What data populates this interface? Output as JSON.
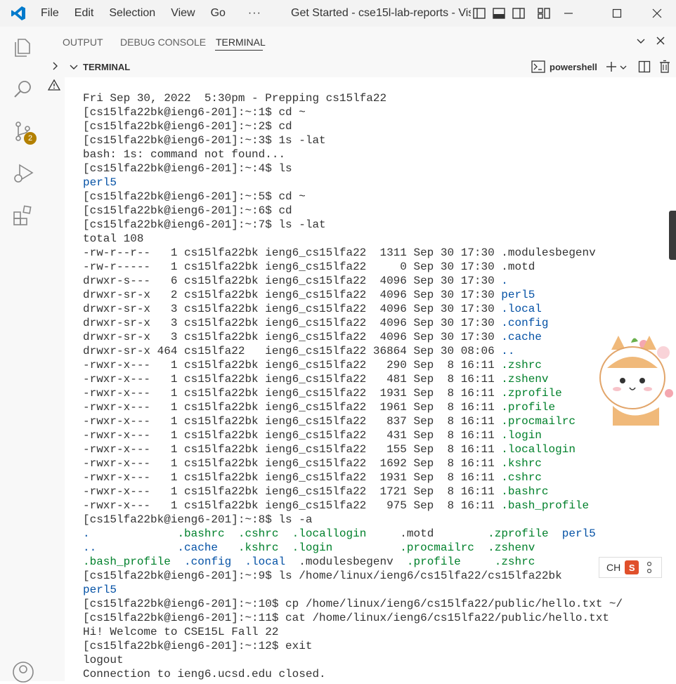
{
  "menu": [
    "File",
    "Edit",
    "Selection",
    "View",
    "Go"
  ],
  "menu_more": "···",
  "window_title": "Get Started - cse15l-lab-reports - Vis",
  "activity": {
    "scm_badge": "2"
  },
  "panel_tabs": [
    {
      "label": "OUTPUT",
      "active": false
    },
    {
      "label": "DEBUG CONSOLE",
      "active": false
    },
    {
      "label": "TERMINAL",
      "active": true
    }
  ],
  "terminal_header": {
    "title": "TERMINAL",
    "shell": "powershell"
  },
  "ime": {
    "label": "CH",
    "logo": "S"
  },
  "colors": {
    "accent": "#007acc",
    "blue_text": "#0451a5",
    "green_text": "#00802b",
    "badge": "#b38000"
  },
  "terminal_lines": [
    [
      {
        "t": "Fri Sep 30, 2022  5:30pm - Prepping cs15lfa22"
      }
    ],
    [
      {
        "t": "[cs15lfa22bk@ieng6-201]:~:1$ cd ~"
      }
    ],
    [
      {
        "t": "[cs15lfa22bk@ieng6-201]:~:2$ cd"
      }
    ],
    [
      {
        "t": "[cs15lfa22bk@ieng6-201]:~:3$ 1s -lat"
      }
    ],
    [
      {
        "t": "bash: 1s: command not found..."
      }
    ],
    [
      {
        "t": "[cs15lfa22bk@ieng6-201]:~:4$ ls"
      }
    ],
    [
      {
        "t": "perl5",
        "c": "blue"
      }
    ],
    [
      {
        "t": "[cs15lfa22bk@ieng6-201]:~:5$ cd ~"
      }
    ],
    [
      {
        "t": "[cs15lfa22bk@ieng6-201]:~:6$ cd"
      }
    ],
    [
      {
        "t": "[cs15lfa22bk@ieng6-201]:~:7$ ls -lat"
      }
    ],
    [
      {
        "t": "total 108"
      }
    ],
    [
      {
        "t": "-rw-r--r--   1 cs15lfa22bk ieng6_cs15lfa22  1311 Sep 30 17:30 .modulesbegenv"
      }
    ],
    [
      {
        "t": "-rw-r-----   1 cs15lfa22bk ieng6_cs15lfa22     0 Sep 30 17:30 .motd"
      }
    ],
    [
      {
        "t": "drwxr-s---   6 cs15lfa22bk ieng6_cs15lfa22  4096 Sep 30 17:30 "
      },
      {
        "t": ".",
        "c": "blue"
      }
    ],
    [
      {
        "t": "drwxr-sr-x   2 cs15lfa22bk ieng6_cs15lfa22  4096 Sep 30 17:30 "
      },
      {
        "t": "perl5",
        "c": "blue"
      }
    ],
    [
      {
        "t": "drwxr-sr-x   3 cs15lfa22bk ieng6_cs15lfa22  4096 Sep 30 17:30 "
      },
      {
        "t": ".local",
        "c": "blue"
      }
    ],
    [
      {
        "t": "drwxr-sr-x   3 cs15lfa22bk ieng6_cs15lfa22  4096 Sep 30 17:30 "
      },
      {
        "t": ".config",
        "c": "blue"
      }
    ],
    [
      {
        "t": "drwxr-sr-x   3 cs15lfa22bk ieng6_cs15lfa22  4096 Sep 30 17:30 "
      },
      {
        "t": ".cache",
        "c": "blue"
      }
    ],
    [
      {
        "t": "drwxr-sr-x 464 cs15lfa22   ieng6_cs15lfa22 36864 Sep 30 08:06 "
      },
      {
        "t": "..",
        "c": "blue"
      }
    ],
    [
      {
        "t": "-rwxr-x---   1 cs15lfa22bk ieng6_cs15lfa22   290 Sep  8 16:11 "
      },
      {
        "t": ".zshrc",
        "c": "green"
      }
    ],
    [
      {
        "t": "-rwxr-x---   1 cs15lfa22bk ieng6_cs15lfa22   481 Sep  8 16:11 "
      },
      {
        "t": ".zshenv",
        "c": "green"
      }
    ],
    [
      {
        "t": "-rwxr-x---   1 cs15lfa22bk ieng6_cs15lfa22  1931 Sep  8 16:11 "
      },
      {
        "t": ".zprofile",
        "c": "green"
      }
    ],
    [
      {
        "t": "-rwxr-x---   1 cs15lfa22bk ieng6_cs15lfa22  1961 Sep  8 16:11 "
      },
      {
        "t": ".profile",
        "c": "green"
      }
    ],
    [
      {
        "t": "-rwxr-x---   1 cs15lfa22bk ieng6_cs15lfa22   837 Sep  8 16:11 "
      },
      {
        "t": ".procmailrc",
        "c": "green"
      }
    ],
    [
      {
        "t": "-rwxr-x---   1 cs15lfa22bk ieng6_cs15lfa22   431 Sep  8 16:11 "
      },
      {
        "t": ".login",
        "c": "green"
      }
    ],
    [
      {
        "t": "-rwxr-x---   1 cs15lfa22bk ieng6_cs15lfa22   155 Sep  8 16:11 "
      },
      {
        "t": ".locallogin",
        "c": "green"
      }
    ],
    [
      {
        "t": "-rwxr-x---   1 cs15lfa22bk ieng6_cs15lfa22  1692 Sep  8 16:11 "
      },
      {
        "t": ".kshrc",
        "c": "green"
      }
    ],
    [
      {
        "t": "-rwxr-x---   1 cs15lfa22bk ieng6_cs15lfa22  1931 Sep  8 16:11 "
      },
      {
        "t": ".cshrc",
        "c": "green"
      }
    ],
    [
      {
        "t": "-rwxr-x---   1 cs15lfa22bk ieng6_cs15lfa22  1721 Sep  8 16:11 "
      },
      {
        "t": ".bashrc",
        "c": "green"
      }
    ],
    [
      {
        "t": "-rwxr-x---   1 cs15lfa22bk ieng6_cs15lfa22   975 Sep  8 16:11 "
      },
      {
        "t": ".bash_profile",
        "c": "green"
      }
    ],
    [
      {
        "t": "[cs15lfa22bk@ieng6-201]:~:8$ ls -a"
      }
    ],
    [
      {
        "t": ".",
        "c": "blue"
      },
      {
        "t": "             "
      },
      {
        "t": ".bashrc",
        "c": "green"
      },
      {
        "t": "  "
      },
      {
        "t": ".cshrc",
        "c": "green"
      },
      {
        "t": "  "
      },
      {
        "t": ".locallogin",
        "c": "green"
      },
      {
        "t": "     .motd        "
      },
      {
        "t": ".zprofile",
        "c": "green"
      },
      {
        "t": "  "
      },
      {
        "t": "perl5",
        "c": "blue"
      }
    ],
    [
      {
        "t": "..",
        "c": "blue"
      },
      {
        "t": "            "
      },
      {
        "t": ".cache",
        "c": "blue"
      },
      {
        "t": "   "
      },
      {
        "t": ".kshrc",
        "c": "green"
      },
      {
        "t": "  "
      },
      {
        "t": ".login",
        "c": "green"
      },
      {
        "t": "          "
      },
      {
        "t": ".procmailrc",
        "c": "green"
      },
      {
        "t": "  "
      },
      {
        "t": ".zshenv",
        "c": "green"
      }
    ],
    [
      {
        "t": ".bash_profile",
        "c": "green"
      },
      {
        "t": "  "
      },
      {
        "t": ".config",
        "c": "blue"
      },
      {
        "t": "  "
      },
      {
        "t": ".local",
        "c": "blue"
      },
      {
        "t": "  .modulesbegenv  "
      },
      {
        "t": ".profile",
        "c": "green"
      },
      {
        "t": "     "
      },
      {
        "t": ".zshrc",
        "c": "green"
      }
    ],
    [
      {
        "t": "[cs15lfa22bk@ieng6-201]:~:9$ ls /home/linux/ieng6/cs15lfa22/cs15lfa22bk"
      }
    ],
    [
      {
        "t": "perl5",
        "c": "blue"
      }
    ],
    [
      {
        "t": "[cs15lfa22bk@ieng6-201]:~:10$ cp /home/linux/ieng6/cs15lfa22/public/hello.txt ~/"
      }
    ],
    [
      {
        "t": "[cs15lfa22bk@ieng6-201]:~:11$ cat /home/linux/ieng6/cs15lfa22/public/hello.txt"
      }
    ],
    [
      {
        "t": "Hi! Welcome to CSE15L Fall 22"
      }
    ],
    [
      {
        "t": "[cs15lfa22bk@ieng6-201]:~:12$ exit"
      }
    ],
    [
      {
        "t": "logout"
      }
    ],
    [
      {
        "t": "Connection to ieng6.ucsd.edu closed."
      }
    ]
  ]
}
